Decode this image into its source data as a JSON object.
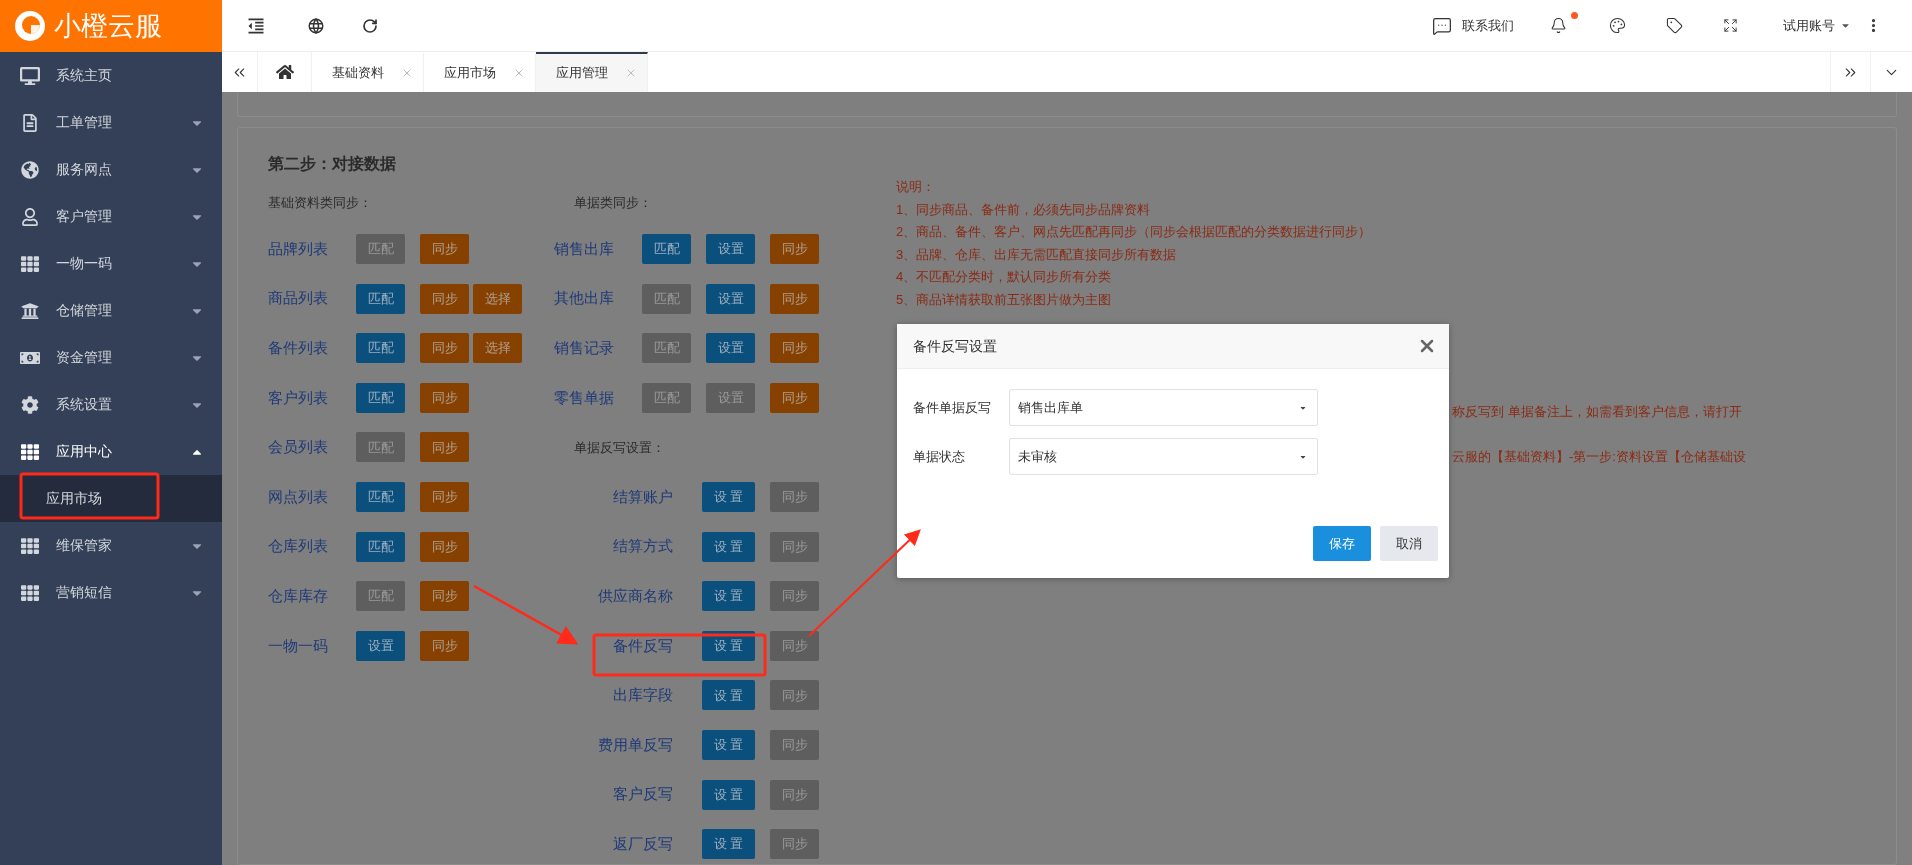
{
  "header": {
    "logo": "小橙云服",
    "contact": "联系我们",
    "unread": true,
    "account": "试用账号"
  },
  "nav_tabs": [
    {
      "label": "基础资料",
      "selected": false
    },
    {
      "label": "应用市场",
      "selected": false
    },
    {
      "label": "应用管理",
      "selected": true
    }
  ],
  "sidebar": {
    "items": [
      {
        "label": "系统主页"
      },
      {
        "label": "工单管理",
        "expanded": false
      },
      {
        "label": "服务网点",
        "expanded": false
      },
      {
        "label": "客户管理",
        "expanded": false
      },
      {
        "label": "一物一码",
        "expanded": false
      },
      {
        "label": "仓储管理",
        "expanded": false
      },
      {
        "label": "资金管理",
        "expanded": false
      },
      {
        "label": "系统设置",
        "expanded": false
      },
      {
        "label": "应用中心",
        "expanded": true,
        "children": [
          {
            "label": "应用市场",
            "selected": true
          }
        ]
      },
      {
        "label": "维保管家",
        "expanded": false
      },
      {
        "label": "营销短信",
        "expanded": false
      }
    ]
  },
  "content": {
    "title": "第二步：对接数据",
    "basic_sync": {
      "heading": "基础资料类同步：",
      "rows": [
        {
          "label": "品牌列表",
          "buttons": [
            {
              "label": "匹配",
              "kind": "match",
              "disabled": true
            },
            {
              "label": "同步",
              "kind": "sync",
              "disabled": false
            }
          ]
        },
        {
          "label": "商品列表",
          "buttons": [
            {
              "label": "匹配",
              "kind": "match",
              "disabled": false
            },
            {
              "label": "同步",
              "kind": "sync",
              "disabled": false
            },
            {
              "label": "选择",
              "kind": "select",
              "disabled": false
            }
          ]
        },
        {
          "label": "备件列表",
          "buttons": [
            {
              "label": "匹配",
              "kind": "match",
              "disabled": false
            },
            {
              "label": "同步",
              "kind": "sync",
              "disabled": false
            },
            {
              "label": "选择",
              "kind": "select",
              "disabled": false
            }
          ]
        },
        {
          "label": "客户列表",
          "buttons": [
            {
              "label": "匹配",
              "kind": "match",
              "disabled": false
            },
            {
              "label": "同步",
              "kind": "sync",
              "disabled": false
            }
          ]
        },
        {
          "label": "会员列表",
          "buttons": [
            {
              "label": "匹配",
              "kind": "match",
              "disabled": true
            },
            {
              "label": "同步",
              "kind": "sync",
              "disabled": false
            }
          ]
        },
        {
          "label": "网点列表",
          "buttons": [
            {
              "label": "匹配",
              "kind": "match",
              "disabled": false
            },
            {
              "label": "同步",
              "kind": "sync",
              "disabled": false
            }
          ]
        },
        {
          "label": "仓库列表",
          "buttons": [
            {
              "label": "匹配",
              "kind": "match",
              "disabled": false
            },
            {
              "label": "同步",
              "kind": "sync",
              "disabled": false
            }
          ]
        },
        {
          "label": "仓库库存",
          "buttons": [
            {
              "label": "匹配",
              "kind": "match",
              "disabled": true
            },
            {
              "label": "同步",
              "kind": "sync",
              "disabled": false
            }
          ]
        },
        {
          "label": "一物一码",
          "buttons": [
            {
              "label": "设置",
              "kind": "setup",
              "disabled": false
            },
            {
              "label": "同步",
              "kind": "sync",
              "disabled": false
            }
          ]
        }
      ]
    },
    "document_sync": {
      "heading": "单据类同步：",
      "rows": [
        {
          "label": "销售出库",
          "buttons": [
            {
              "label": "匹配",
              "kind": "match",
              "disabled": false
            },
            {
              "label": "设置",
              "kind": "setup",
              "disabled": false
            },
            {
              "label": "同步",
              "kind": "sync",
              "disabled": false
            }
          ]
        },
        {
          "label": "其他出库",
          "buttons": [
            {
              "label": "匹配",
              "kind": "match",
              "disabled": true
            },
            {
              "label": "设置",
              "kind": "setup",
              "disabled": false
            },
            {
              "label": "同步",
              "kind": "sync",
              "disabled": false
            }
          ]
        },
        {
          "label": "销售记录",
          "buttons": [
            {
              "label": "匹配",
              "kind": "match",
              "disabled": true
            },
            {
              "label": "设置",
              "kind": "setup",
              "disabled": false
            },
            {
              "label": "同步",
              "kind": "sync",
              "disabled": false
            }
          ]
        },
        {
          "label": "零售单据",
          "buttons": [
            {
              "label": "匹配",
              "kind": "match",
              "disabled": true
            },
            {
              "label": "设置",
              "kind": "setup",
              "disabled": true
            },
            {
              "label": "同步",
              "kind": "sync",
              "disabled": false
            }
          ]
        }
      ]
    },
    "writeback": {
      "heading": "单据反写设置：",
      "rows": [
        {
          "label": "结算账户",
          "buttons": [
            {
              "label": "设 置",
              "kind": "setup",
              "disabled": false
            },
            {
              "label": "同步",
              "kind": "sync",
              "disabled": true
            }
          ]
        },
        {
          "label": "结算方式",
          "buttons": [
            {
              "label": "设 置",
              "kind": "setup",
              "disabled": false
            },
            {
              "label": "同步",
              "kind": "sync",
              "disabled": true
            }
          ]
        },
        {
          "label": "供应商名称",
          "buttons": [
            {
              "label": "设 置",
              "kind": "setup",
              "disabled": false
            },
            {
              "label": "同步",
              "kind": "sync",
              "disabled": true
            }
          ]
        },
        {
          "label": "备件反写",
          "buttons": [
            {
              "label": "设 置",
              "kind": "setup",
              "disabled": false
            },
            {
              "label": "同步",
              "kind": "sync",
              "disabled": true
            }
          ]
        },
        {
          "label": "出库字段",
          "buttons": [
            {
              "label": "设 置",
              "kind": "setup",
              "disabled": false
            },
            {
              "label": "同步",
              "kind": "sync",
              "disabled": true
            }
          ]
        },
        {
          "label": "费用单反写",
          "buttons": [
            {
              "label": "设 置",
              "kind": "setup",
              "disabled": false
            },
            {
              "label": "同步",
              "kind": "sync",
              "disabled": true
            }
          ]
        },
        {
          "label": "客户反写",
          "buttons": [
            {
              "label": "设 置",
              "kind": "setup",
              "disabled": false
            },
            {
              "label": "同步",
              "kind": "sync",
              "disabled": true
            }
          ]
        },
        {
          "label": "返厂反写",
          "buttons": [
            {
              "label": "设 置",
              "kind": "setup",
              "disabled": false
            },
            {
              "label": "同步",
              "kind": "sync",
              "disabled": true
            }
          ]
        }
      ]
    },
    "notes": [
      {
        "text": "说明：",
        "kind": "line"
      },
      {
        "text": "1、同步商品、备件前，必须先同步品牌资料",
        "kind": "line"
      },
      {
        "text": "2、商品、备件、客户、网点先匹配再同步（同步会根据匹配的分类数据进行同步）",
        "kind": "line"
      },
      {
        "text": "3、品牌、仓库、出库无需匹配直接同步所有数据",
        "kind": "line"
      },
      {
        "text": "4、不匹配分类时，默认同步所有分类",
        "kind": "line"
      },
      {
        "text": "5、商品详情获取前五张图片做为主图",
        "kind": "line"
      },
      {
        "text": "称反写到 单据备注上，如需看到客户信息，请打开",
        "kind": "tail"
      },
      {
        "text": "云服的【基础资料】-第一步:资料设置【仓储基础设",
        "kind": "tail"
      }
    ]
  },
  "dialog": {
    "title": "备件反写设置",
    "fields": [
      {
        "label": "备件单据反写",
        "value": "销售出库单"
      },
      {
        "label": "单据状态",
        "value": "未审核"
      }
    ],
    "buttons": [
      {
        "label": "保存",
        "kind": "primary"
      },
      {
        "label": "取消",
        "kind": "default"
      }
    ]
  }
}
